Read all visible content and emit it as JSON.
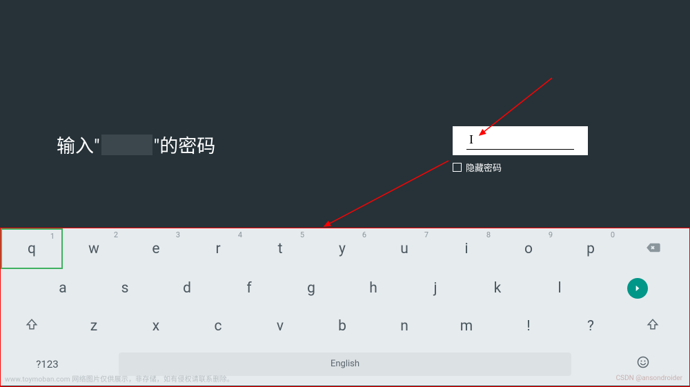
{
  "prompt": {
    "prefix": "输入\"",
    "suffix": "\"的密码"
  },
  "input": {
    "value": "",
    "cursor": "I"
  },
  "hide_password": {
    "label": "隐藏密码",
    "checked": false
  },
  "keyboard": {
    "row1": [
      {
        "char": "q",
        "hint": "1"
      },
      {
        "char": "w",
        "hint": "2"
      },
      {
        "char": "e",
        "hint": "3"
      },
      {
        "char": "r",
        "hint": "4"
      },
      {
        "char": "t",
        "hint": "5"
      },
      {
        "char": "y",
        "hint": "6"
      },
      {
        "char": "u",
        "hint": "7"
      },
      {
        "char": "i",
        "hint": "8"
      },
      {
        "char": "o",
        "hint": "9"
      },
      {
        "char": "p",
        "hint": "0"
      }
    ],
    "row2": [
      {
        "char": "a"
      },
      {
        "char": "s"
      },
      {
        "char": "d"
      },
      {
        "char": "f"
      },
      {
        "char": "g"
      },
      {
        "char": "h"
      },
      {
        "char": "j"
      },
      {
        "char": "k"
      },
      {
        "char": "l"
      }
    ],
    "row3": [
      {
        "char": "z"
      },
      {
        "char": "x"
      },
      {
        "char": "c"
      },
      {
        "char": "v"
      },
      {
        "char": "b"
      },
      {
        "char": "n"
      },
      {
        "char": "m"
      },
      {
        "char": "!"
      },
      {
        "char": "?"
      }
    ],
    "mode_key": "?123",
    "space_label": "English",
    "focused_key": "q"
  },
  "annotations": {
    "footer": "www.toymoban.com 网络图片仅供展示，非存储，如有侵权请联系删除。",
    "watermark": "CSDN @ansondroider"
  },
  "colors": {
    "bg": "#263238",
    "keyboard_bg": "#e6ebee",
    "key_text": "#4b575f",
    "accent": "#009688",
    "arrow": "#ff0000",
    "focus_border": "#40b060"
  }
}
